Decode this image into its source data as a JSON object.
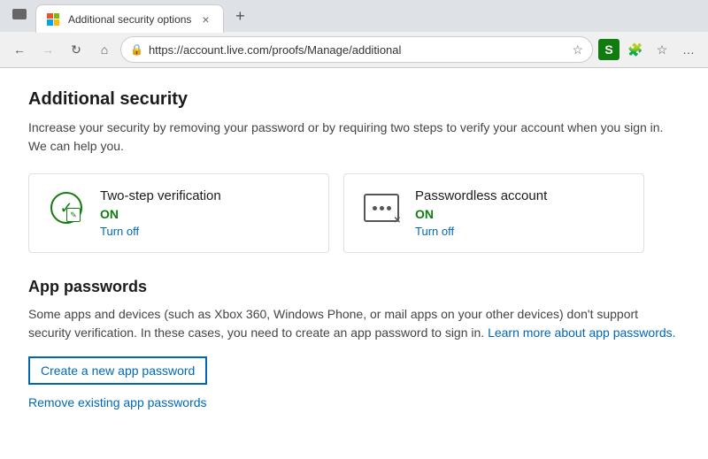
{
  "browser": {
    "tab": {
      "label": "Additional security options",
      "close_icon": "×",
      "new_tab_icon": "+"
    },
    "nav": {
      "back_icon": "←",
      "forward_icon": "→",
      "refresh_icon": "↻",
      "home_icon": "⌂",
      "url": "https://account.live.com/proofs/Manage/additional"
    },
    "toolbar": {
      "security_icon": "S",
      "extensions_icon": "🧩",
      "favorites_icon": "☆",
      "menu_icon": "…"
    }
  },
  "page": {
    "title": "Additional security",
    "description": "Increase your security by removing your password or by requiring two steps to verify your account when you sign in. We can help you.",
    "cards": [
      {
        "id": "two-step",
        "title": "Two-step verification",
        "status": "ON",
        "action": "Turn off"
      },
      {
        "id": "passwordless",
        "title": "Passwordless account",
        "status": "ON",
        "action": "Turn off"
      }
    ],
    "app_passwords": {
      "title": "App passwords",
      "description": "Some apps and devices (such as Xbox 360, Windows Phone, or mail apps on your other devices) don't support security verification. In these cases, you need to create an app password to sign in.",
      "learn_more": "Learn more about app passwords.",
      "create_label": "Create a new app password",
      "remove_label": "Remove existing app passwords"
    }
  }
}
